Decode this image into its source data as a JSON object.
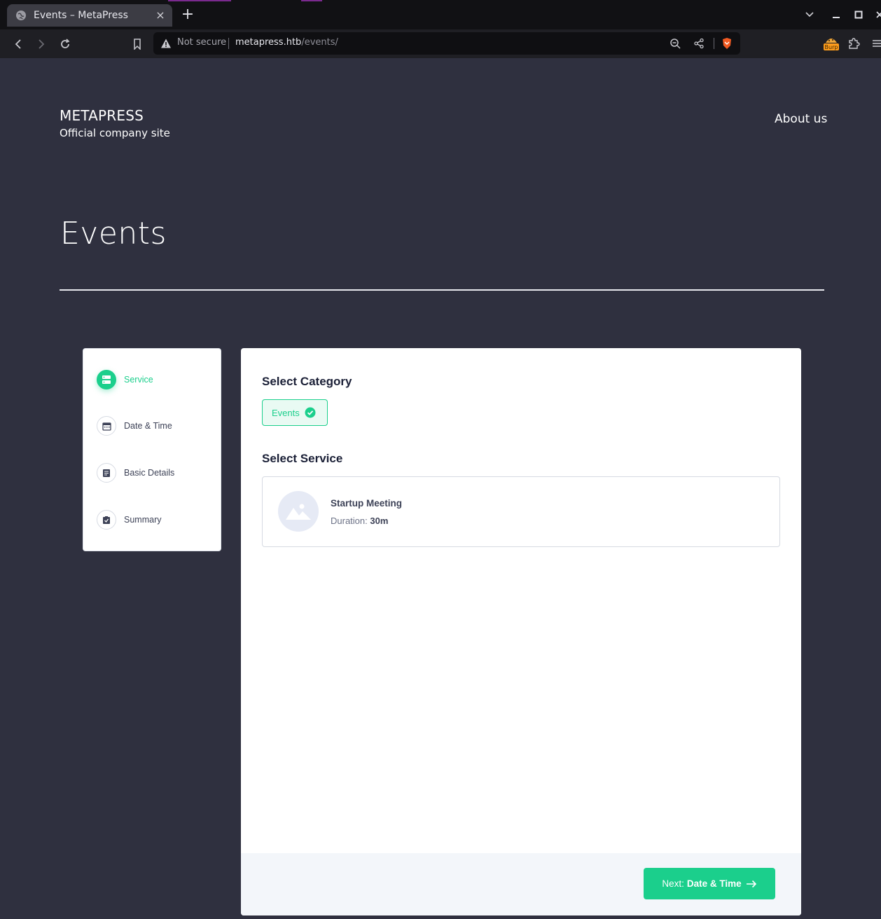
{
  "browser": {
    "tab_title": "Events – MetaPress",
    "new_tab": "+",
    "close_tab": "×",
    "security_label": "Not secure",
    "url_host": "metapress.htb",
    "url_path": "/events/",
    "extension_label": "Burp"
  },
  "site": {
    "name": "METAPRESS",
    "tagline": "Official company site",
    "nav_about": "About us"
  },
  "page": {
    "title": "Events"
  },
  "steps": [
    {
      "label": "Service",
      "icon": "server-icon",
      "active": true
    },
    {
      "label": "Date & Time",
      "icon": "calendar-icon",
      "active": false
    },
    {
      "label": "Basic Details",
      "icon": "document-icon",
      "active": false
    },
    {
      "label": "Summary",
      "icon": "clipboard-check-icon",
      "active": false
    }
  ],
  "booking": {
    "category_heading": "Select Category",
    "category_chip": "Events",
    "service_heading": "Select Service",
    "service": {
      "name": "Startup Meeting",
      "duration_label": "Duration:",
      "duration_value": "30m"
    },
    "next_prefix": "Next:",
    "next_target": "Date & Time"
  },
  "colors": {
    "accent": "#1bcf8c",
    "page_bg": "#2f303f"
  }
}
